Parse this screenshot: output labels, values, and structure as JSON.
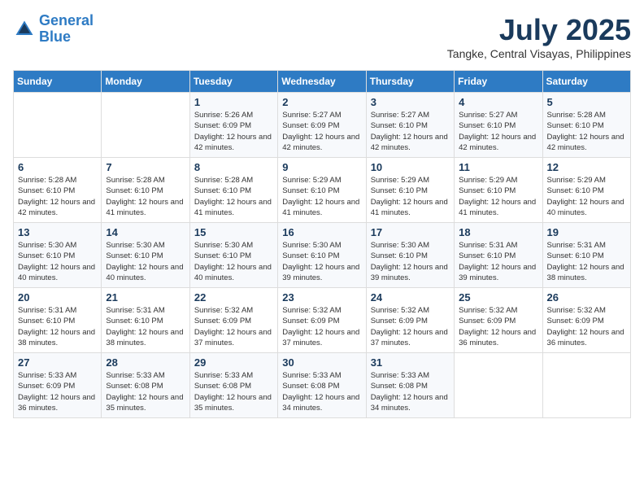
{
  "header": {
    "logo_line1": "General",
    "logo_line2": "Blue",
    "month_year": "July 2025",
    "location": "Tangke, Central Visayas, Philippines"
  },
  "weekdays": [
    "Sunday",
    "Monday",
    "Tuesday",
    "Wednesday",
    "Thursday",
    "Friday",
    "Saturday"
  ],
  "weeks": [
    [
      {
        "day": "",
        "info": ""
      },
      {
        "day": "",
        "info": ""
      },
      {
        "day": "1",
        "info": "Sunrise: 5:26 AM\nSunset: 6:09 PM\nDaylight: 12 hours and 42 minutes."
      },
      {
        "day": "2",
        "info": "Sunrise: 5:27 AM\nSunset: 6:09 PM\nDaylight: 12 hours and 42 minutes."
      },
      {
        "day": "3",
        "info": "Sunrise: 5:27 AM\nSunset: 6:10 PM\nDaylight: 12 hours and 42 minutes."
      },
      {
        "day": "4",
        "info": "Sunrise: 5:27 AM\nSunset: 6:10 PM\nDaylight: 12 hours and 42 minutes."
      },
      {
        "day": "5",
        "info": "Sunrise: 5:28 AM\nSunset: 6:10 PM\nDaylight: 12 hours and 42 minutes."
      }
    ],
    [
      {
        "day": "6",
        "info": "Sunrise: 5:28 AM\nSunset: 6:10 PM\nDaylight: 12 hours and 42 minutes."
      },
      {
        "day": "7",
        "info": "Sunrise: 5:28 AM\nSunset: 6:10 PM\nDaylight: 12 hours and 41 minutes."
      },
      {
        "day": "8",
        "info": "Sunrise: 5:28 AM\nSunset: 6:10 PM\nDaylight: 12 hours and 41 minutes."
      },
      {
        "day": "9",
        "info": "Sunrise: 5:29 AM\nSunset: 6:10 PM\nDaylight: 12 hours and 41 minutes."
      },
      {
        "day": "10",
        "info": "Sunrise: 5:29 AM\nSunset: 6:10 PM\nDaylight: 12 hours and 41 minutes."
      },
      {
        "day": "11",
        "info": "Sunrise: 5:29 AM\nSunset: 6:10 PM\nDaylight: 12 hours and 41 minutes."
      },
      {
        "day": "12",
        "info": "Sunrise: 5:29 AM\nSunset: 6:10 PM\nDaylight: 12 hours and 40 minutes."
      }
    ],
    [
      {
        "day": "13",
        "info": "Sunrise: 5:30 AM\nSunset: 6:10 PM\nDaylight: 12 hours and 40 minutes."
      },
      {
        "day": "14",
        "info": "Sunrise: 5:30 AM\nSunset: 6:10 PM\nDaylight: 12 hours and 40 minutes."
      },
      {
        "day": "15",
        "info": "Sunrise: 5:30 AM\nSunset: 6:10 PM\nDaylight: 12 hours and 40 minutes."
      },
      {
        "day": "16",
        "info": "Sunrise: 5:30 AM\nSunset: 6:10 PM\nDaylight: 12 hours and 39 minutes."
      },
      {
        "day": "17",
        "info": "Sunrise: 5:30 AM\nSunset: 6:10 PM\nDaylight: 12 hours and 39 minutes."
      },
      {
        "day": "18",
        "info": "Sunrise: 5:31 AM\nSunset: 6:10 PM\nDaylight: 12 hours and 39 minutes."
      },
      {
        "day": "19",
        "info": "Sunrise: 5:31 AM\nSunset: 6:10 PM\nDaylight: 12 hours and 38 minutes."
      }
    ],
    [
      {
        "day": "20",
        "info": "Sunrise: 5:31 AM\nSunset: 6:10 PM\nDaylight: 12 hours and 38 minutes."
      },
      {
        "day": "21",
        "info": "Sunrise: 5:31 AM\nSunset: 6:10 PM\nDaylight: 12 hours and 38 minutes."
      },
      {
        "day": "22",
        "info": "Sunrise: 5:32 AM\nSunset: 6:09 PM\nDaylight: 12 hours and 37 minutes."
      },
      {
        "day": "23",
        "info": "Sunrise: 5:32 AM\nSunset: 6:09 PM\nDaylight: 12 hours and 37 minutes."
      },
      {
        "day": "24",
        "info": "Sunrise: 5:32 AM\nSunset: 6:09 PM\nDaylight: 12 hours and 37 minutes."
      },
      {
        "day": "25",
        "info": "Sunrise: 5:32 AM\nSunset: 6:09 PM\nDaylight: 12 hours and 36 minutes."
      },
      {
        "day": "26",
        "info": "Sunrise: 5:32 AM\nSunset: 6:09 PM\nDaylight: 12 hours and 36 minutes."
      }
    ],
    [
      {
        "day": "27",
        "info": "Sunrise: 5:33 AM\nSunset: 6:09 PM\nDaylight: 12 hours and 36 minutes."
      },
      {
        "day": "28",
        "info": "Sunrise: 5:33 AM\nSunset: 6:08 PM\nDaylight: 12 hours and 35 minutes."
      },
      {
        "day": "29",
        "info": "Sunrise: 5:33 AM\nSunset: 6:08 PM\nDaylight: 12 hours and 35 minutes."
      },
      {
        "day": "30",
        "info": "Sunrise: 5:33 AM\nSunset: 6:08 PM\nDaylight: 12 hours and 34 minutes."
      },
      {
        "day": "31",
        "info": "Sunrise: 5:33 AM\nSunset: 6:08 PM\nDaylight: 12 hours and 34 minutes."
      },
      {
        "day": "",
        "info": ""
      },
      {
        "day": "",
        "info": ""
      }
    ]
  ]
}
